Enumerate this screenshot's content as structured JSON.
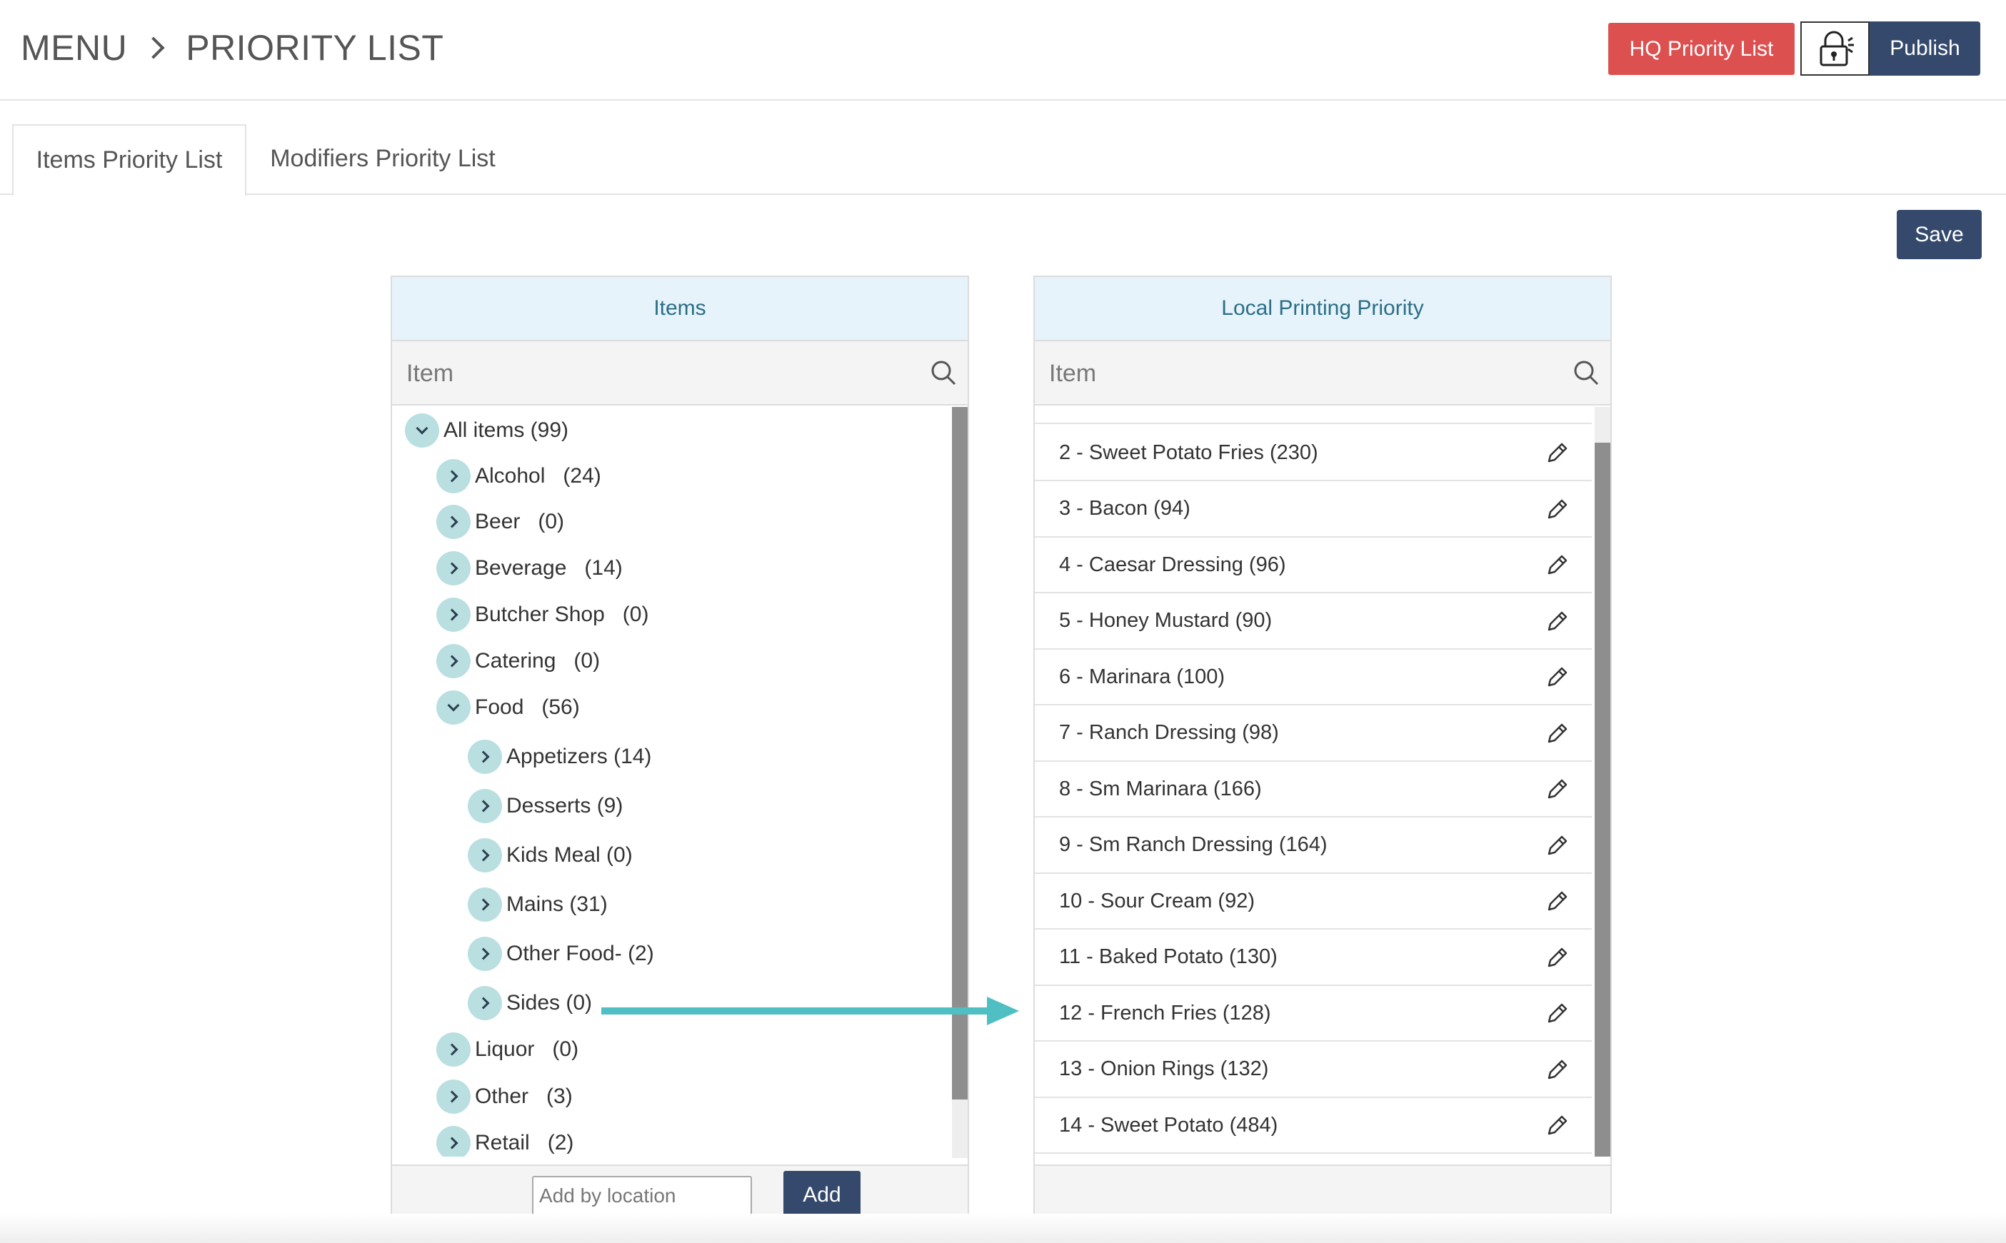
{
  "header": {
    "breadcrumb": [
      "MENU",
      "PRIORITY LIST"
    ],
    "hq_button": "HQ Priority List",
    "lock_icon": "lock-icon",
    "publish_button": "Publish"
  },
  "tabs": [
    {
      "label": "Items Priority List",
      "active": true
    },
    {
      "label": "Modifiers Priority List",
      "active": false
    }
  ],
  "save_button": "Save",
  "items_panel": {
    "title": "Items",
    "search_placeholder": "Item",
    "tree": [
      {
        "label": "All items (99)",
        "expanded": true
      },
      {
        "label": "Alcohol   (24)",
        "expanded": false
      },
      {
        "label": "Beer   (0)",
        "expanded": false
      },
      {
        "label": "Beverage   (14)",
        "expanded": false
      },
      {
        "label": "Butcher Shop   (0)",
        "expanded": false
      },
      {
        "label": "Catering   (0)",
        "expanded": false
      },
      {
        "label": "Food   (56)",
        "expanded": true
      },
      {
        "label": "Appetizers (14)",
        "expanded": false
      },
      {
        "label": "Desserts (9)",
        "expanded": false
      },
      {
        "label": "Kids Meal (0)",
        "expanded": false
      },
      {
        "label": "Mains (31)",
        "expanded": false
      },
      {
        "label": "Other Food- (2)",
        "expanded": false
      },
      {
        "label": "Sides (0)",
        "expanded": false
      },
      {
        "label": "Liquor   (0)",
        "expanded": false
      },
      {
        "label": "Other   (3)",
        "expanded": false
      },
      {
        "label": "Retail   (2)",
        "expanded": false
      }
    ],
    "location_placeholder": "Add by location",
    "add_button": "Add"
  },
  "priority_panel": {
    "title": "Local Printing Priority",
    "search_placeholder": "Item",
    "items": [
      "2 - Sweet Potato Fries (230)",
      "3 - Bacon (94)",
      "4 - Caesar Dressing (96)",
      "5 - Honey Mustard (90)",
      "6 - Marinara (100)",
      "7 - Ranch Dressing (98)",
      "8 - Sm Marinara (166)",
      "9 - Sm Ranch Dressing (164)",
      "10 - Sour Cream (92)",
      "11 - Baked Potato (130)",
      "12 - French Fries (128)",
      "13 - Onion Rings (132)",
      "14 - Sweet Potato (484)"
    ]
  },
  "colors": {
    "accent_red": "#dd5050",
    "navy": "#34496b",
    "panel_head": "#e6f3fb",
    "toggle": "#b9dfe0",
    "arrow": "#4fbfc4"
  }
}
